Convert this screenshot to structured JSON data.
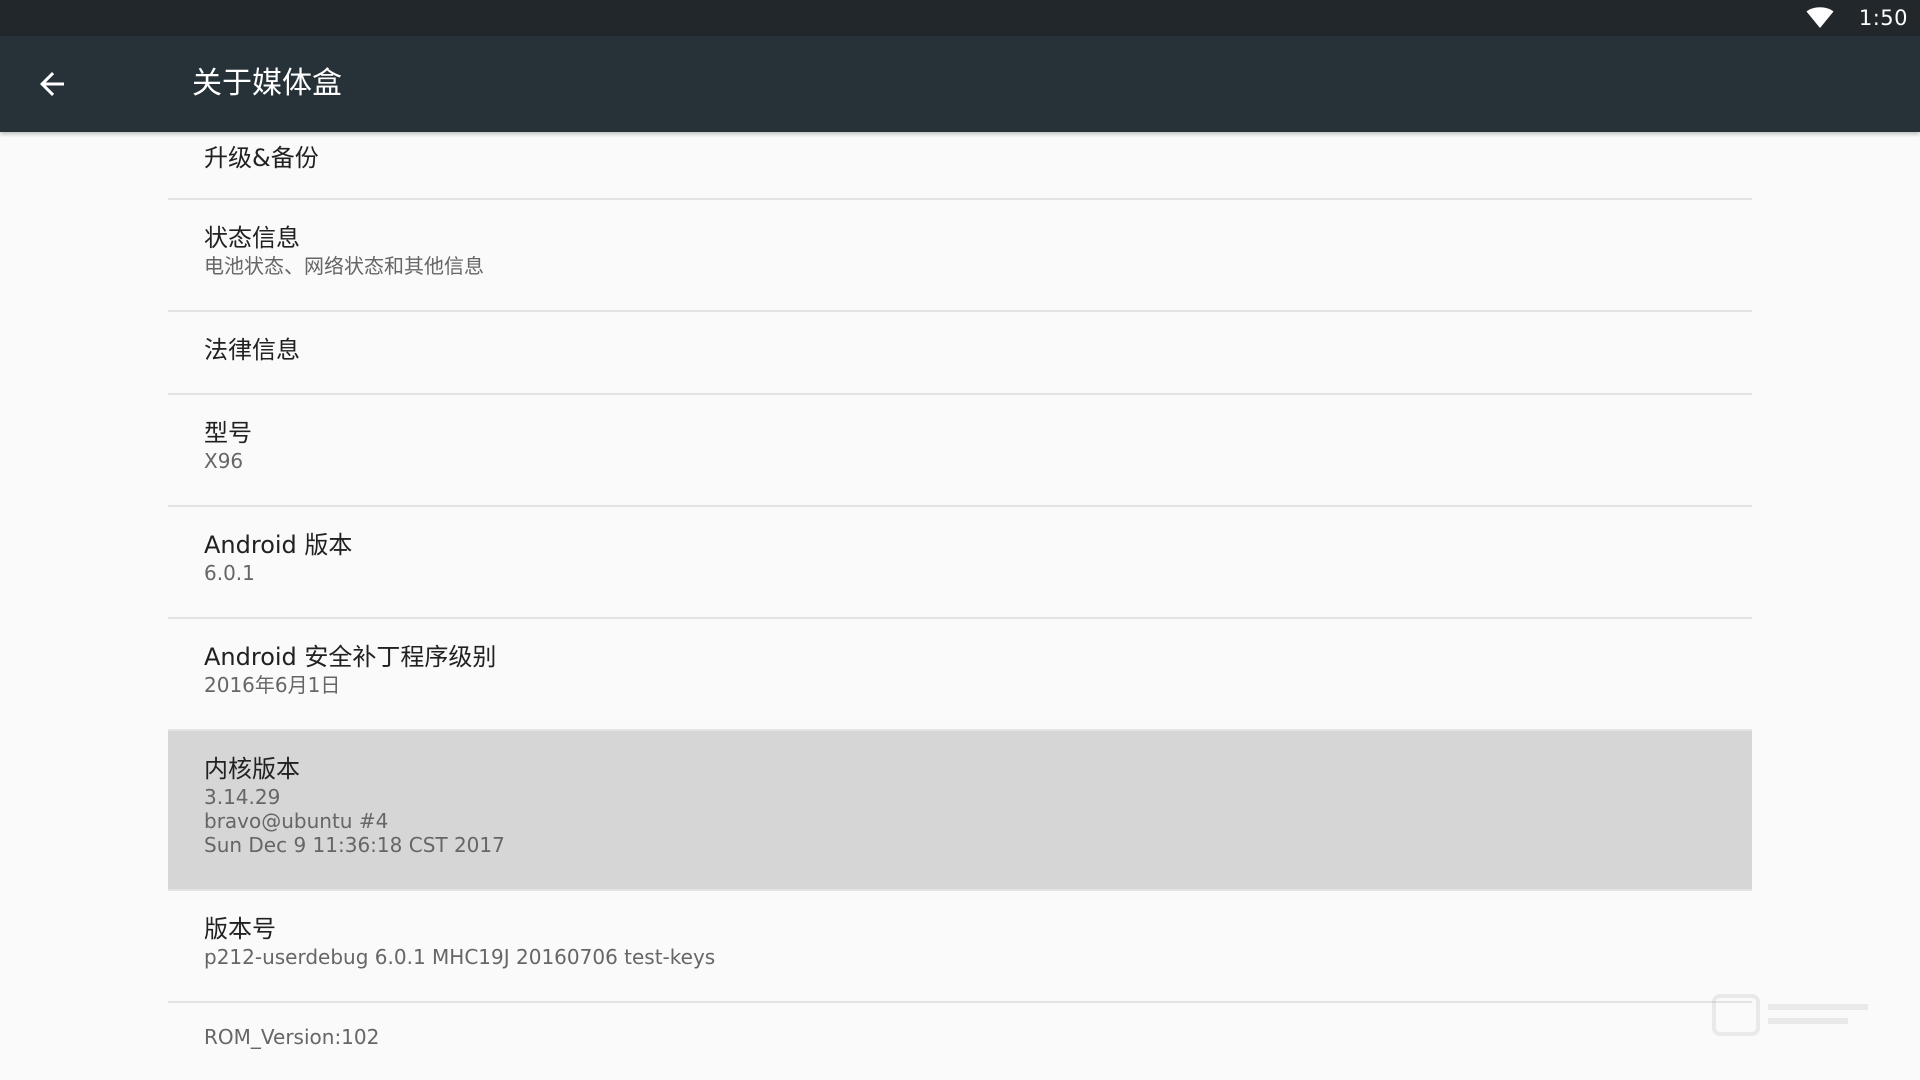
{
  "status_bar": {
    "time": "1:50",
    "wifi_icon": "wifi-icon"
  },
  "app_bar": {
    "back_icon": "arrow-back-icon",
    "title": "关于媒体盒"
  },
  "items": [
    {
      "title": "升级&备份",
      "summary": ""
    },
    {
      "title": "状态信息",
      "summary": "电池状态、网络状态和其他信息"
    },
    {
      "title": "法律信息",
      "summary": ""
    },
    {
      "title": "型号",
      "summary": "X96"
    },
    {
      "title": "Android 版本",
      "summary": "6.0.1"
    },
    {
      "title": "Android 安全补丁程序级别",
      "summary": "2016年6月1日"
    },
    {
      "title": "内核版本",
      "summary_lines": [
        "3.14.29",
        "bravo@ubuntu #4",
        "Sun Dec 9 11:36:18 CST 2017"
      ]
    },
    {
      "title": "版本号",
      "summary": "p212-userdebug 6.0.1 MHC19J 20160706 test-keys"
    },
    {
      "title": "",
      "summary": "ROM_Version:102"
    }
  ],
  "colors": {
    "status_bar": "#21272b",
    "app_bar": "#263238",
    "background": "#fafafa",
    "selected_row": "#d6d6d6",
    "divider": "#e3e3e3"
  }
}
